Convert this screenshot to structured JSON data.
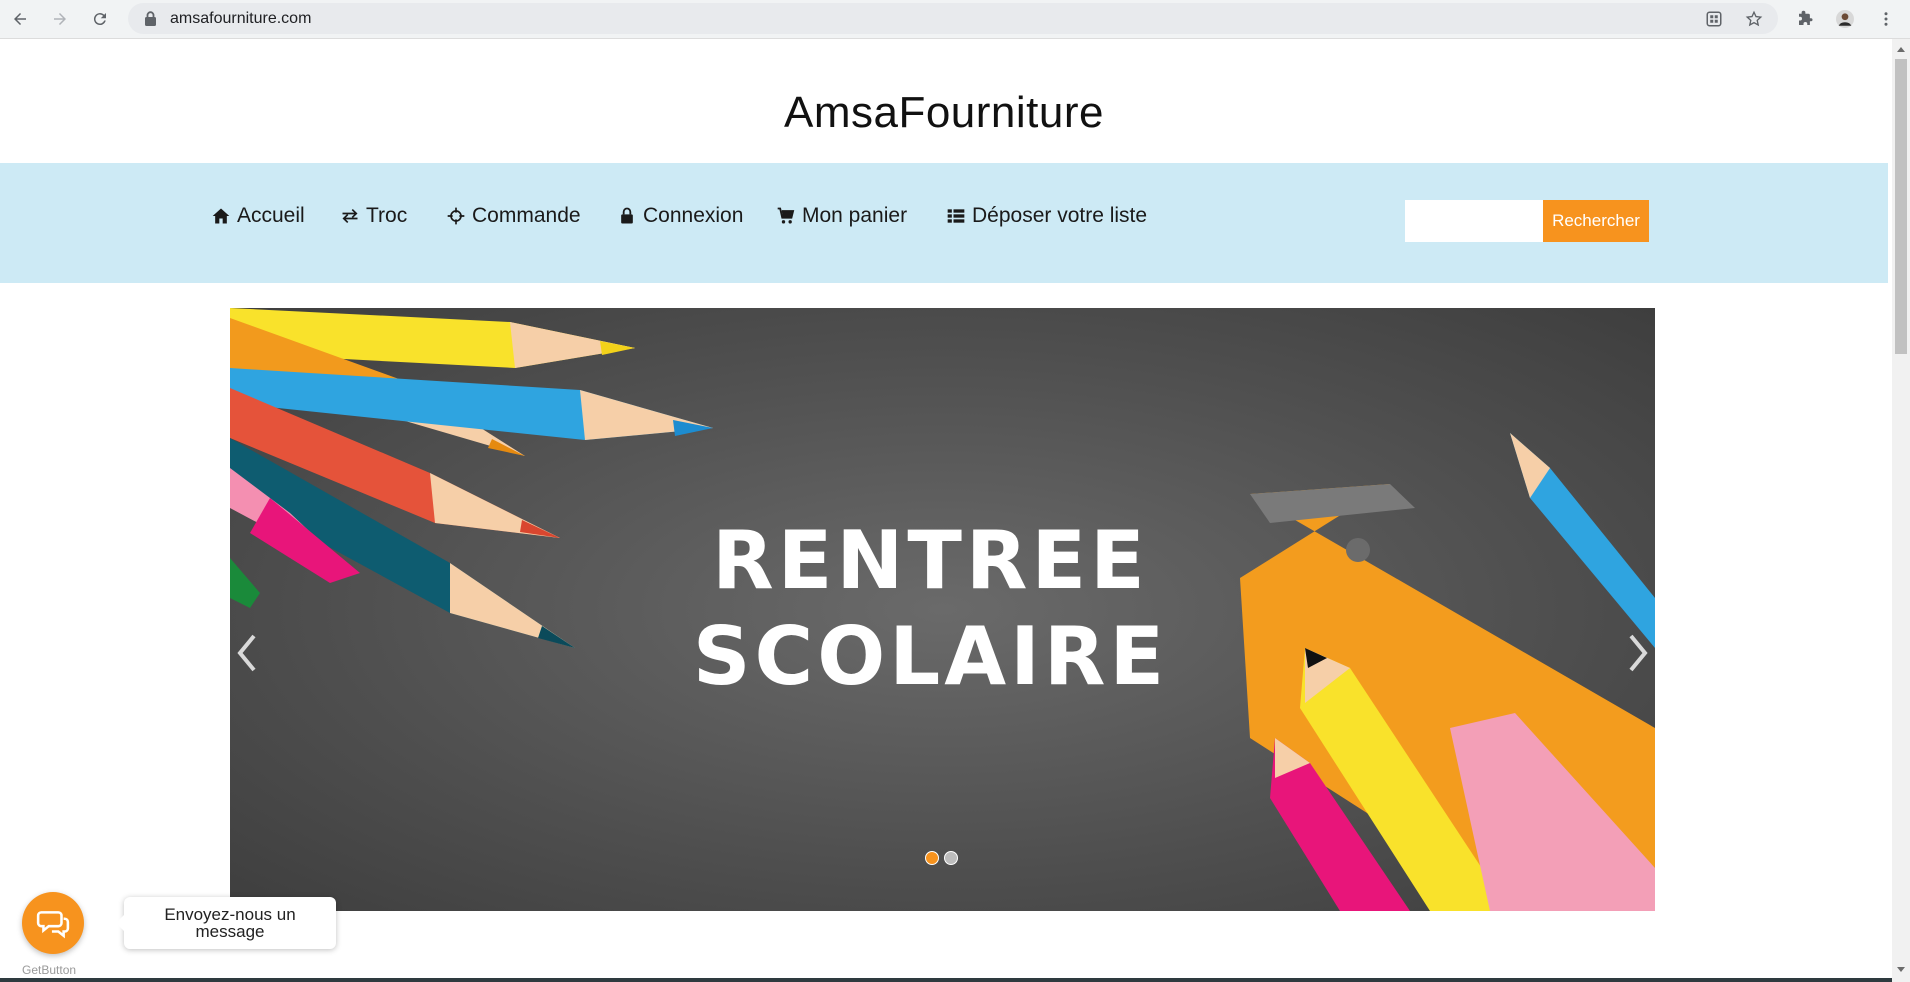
{
  "browser": {
    "url": "amsafourniture.com"
  },
  "site": {
    "title": "AmsaFourniture"
  },
  "nav": {
    "items": [
      {
        "label": "Accueil",
        "icon": "home-icon"
      },
      {
        "label": "Troc",
        "icon": "exchange-icon"
      },
      {
        "label": "Commande",
        "icon": "crosshairs-icon"
      },
      {
        "label": "Connexion",
        "icon": "lock-icon"
      },
      {
        "label": "Mon panier",
        "icon": "shopping-cart-icon"
      },
      {
        "label": "Déposer votre liste",
        "icon": "list-icon"
      }
    ],
    "search_placeholder": "",
    "search_button": "Rechercher"
  },
  "carousel": {
    "line1": "RENTREE",
    "line2": "SCOLAIRE",
    "slide_count": 2,
    "active_slide": 1
  },
  "chat": {
    "message": "Envoyez-nous un message",
    "brand": "GetButton"
  },
  "colors": {
    "accent": "#f7931e",
    "nav_bg": "#cdeaf5",
    "banner_bg": "#555555"
  }
}
